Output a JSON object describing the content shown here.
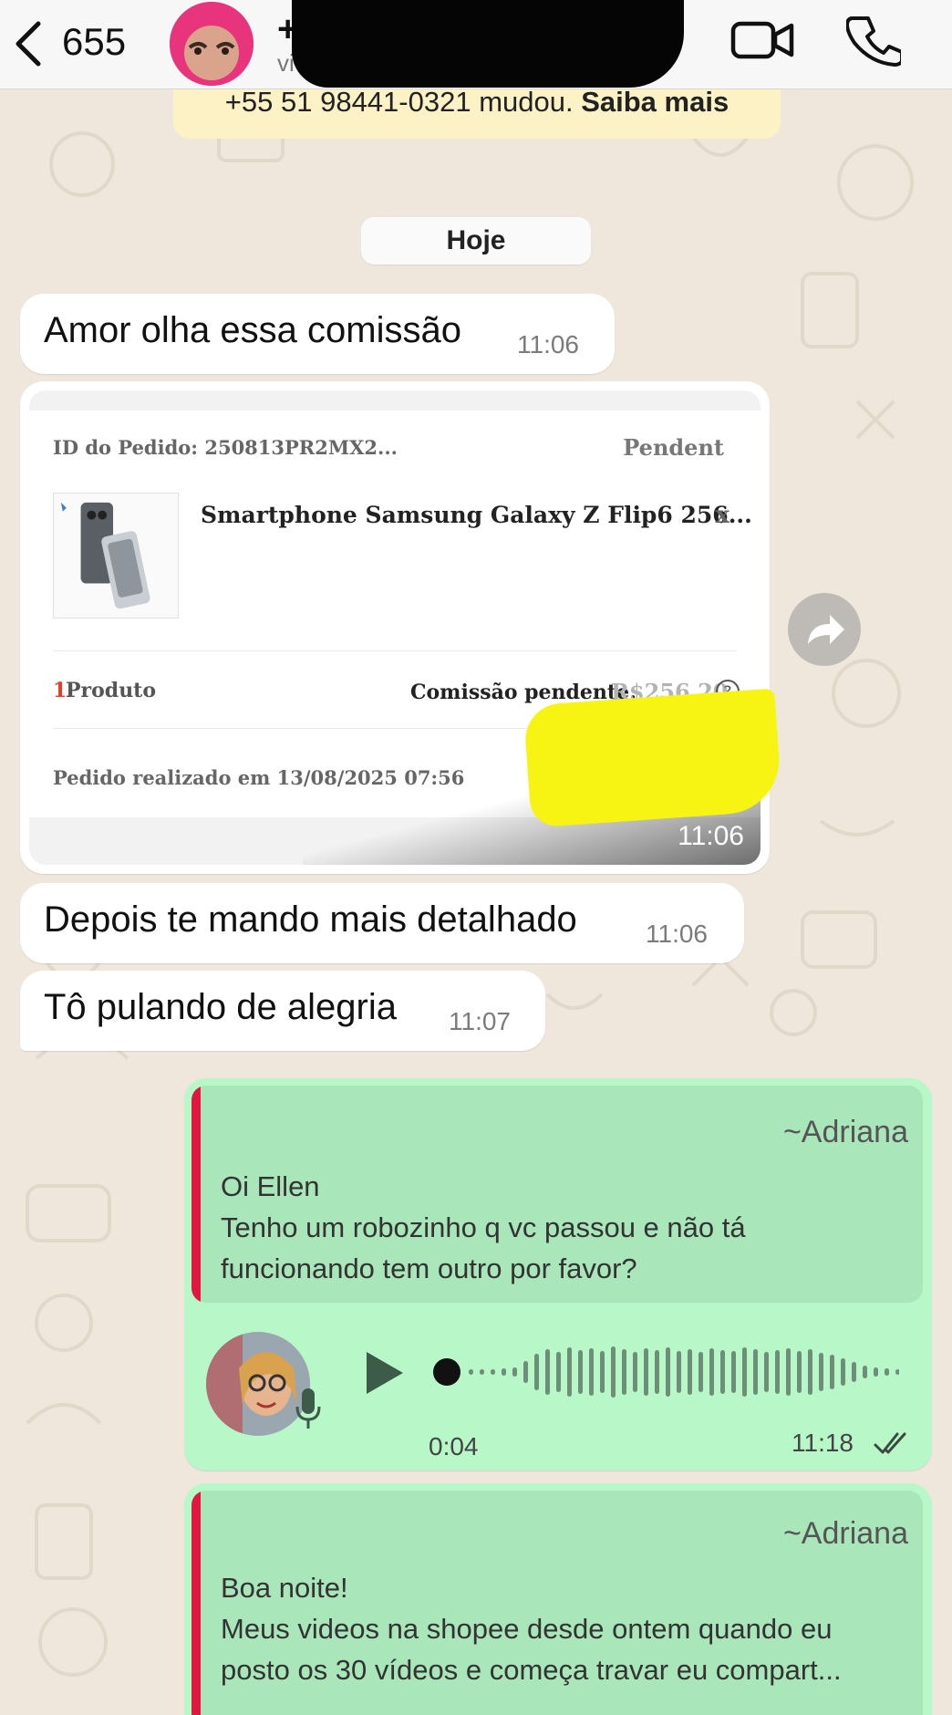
{
  "header": {
    "unread_count": "655",
    "contact_name": "+",
    "contact_sub": "vi"
  },
  "system_banner": {
    "text": "+55 51 98441-0321 mudou.",
    "link": "Saiba mais"
  },
  "date_chip": "Hoje",
  "messages_in": [
    {
      "text": "Amor olha essa comissão",
      "time": "11:06"
    },
    {
      "text": "Depois te mando mais detalhado",
      "time": "11:06"
    },
    {
      "text": "Tô pulando de alegria",
      "time": "11:07"
    }
  ],
  "order_card": {
    "order_id": "ID do Pedido: 250813PR2MX2...",
    "status": "Pendent",
    "product_name": "Smartphone Samsung Galaxy Z Flip6 256...",
    "remove": "x",
    "quantity": "1",
    "quantity_label": "Produto",
    "commission_label": "Comissão pendente:",
    "commission_value": "R$256,20",
    "help": "?",
    "order_date": "Pedido realizado em 13/08/2025 07:56",
    "time": "11:06"
  },
  "outgoing": [
    {
      "quote_author": "~Adriana",
      "quote_lines": [
        "Oi Ellen",
        "Tenho um robozinho q vc passou e não tá",
        "funcionando tem outro por favor?"
      ],
      "voice_duration": "0:04",
      "time": "11:18"
    },
    {
      "quote_author": "~Adriana",
      "quote_lines": [
        "Boa noite!",
        "Meus videos na shopee desde ontem quando eu",
        "posto os 30 vídeos e começa travar eu compart..."
      ]
    }
  ],
  "icons": {
    "back": "chevron-left",
    "video": "video-camera",
    "phone": "phone",
    "forward": "forward-arrow",
    "play": "play-triangle",
    "mic": "microphone",
    "ticks": "double-check"
  },
  "colors": {
    "header_bg": "#f7f7f7",
    "chat_bg": "#efe7dc",
    "incoming_bubble": "#ffffff",
    "outgoing_bubble": "#b8f8c8",
    "quote_bg": "#a9e6b9",
    "quote_bar": "#e0173f",
    "banner_bg": "#fdf1c6",
    "highlight": "#f7f414"
  }
}
